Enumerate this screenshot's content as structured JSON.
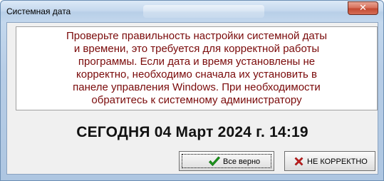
{
  "window": {
    "title": "Системная дата",
    "close_glyph": "✕"
  },
  "message": {
    "lines": [
      "Проверьте правильность настройки системной даты",
      "и времени, это требуется для корректной работы",
      "программы. Если дата и время установлены не",
      "корректно, необходимо сначала их установить в",
      "панеле управления Windows. При необходимости",
      "обратитесь к системному администратору"
    ],
    "color": "#7a0a0a"
  },
  "today": {
    "text": "СЕГОДНЯ 04 Март 2024 г. 14:19"
  },
  "buttons": {
    "ok": {
      "label": "Все верно",
      "icon": "check-icon",
      "icon_color": "#1e9a1e"
    },
    "bad": {
      "label": "НЕ КОРРЕКТНО",
      "icon": "cross-icon",
      "icon_color": "#c81e1e"
    }
  }
}
